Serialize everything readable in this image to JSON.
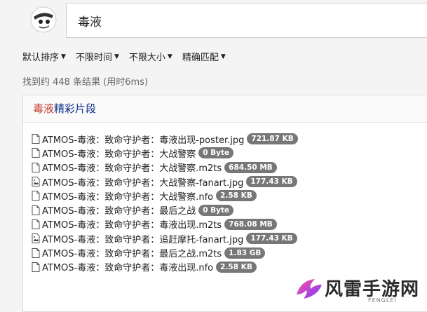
{
  "search": {
    "query": "毒液"
  },
  "filters": [
    {
      "label": "默认排序"
    },
    {
      "label": "不限时间"
    },
    {
      "label": "不限大小"
    },
    {
      "label": "精确匹配"
    }
  ],
  "stats": "找到约 448 条结果 (用时6ms)",
  "panel": {
    "title_highlight": "毒液",
    "title_rest": "精彩片段"
  },
  "files": [
    {
      "icon": "file-icon",
      "name": "ATMOS-毒液：致命守护者：毒液出现-poster.jpg",
      "size": "721.87 KB"
    },
    {
      "icon": "file-icon",
      "name": "ATMOS-毒液：致命守护者：大战警察",
      "size": "0 Byte"
    },
    {
      "icon": "file-icon",
      "name": "ATMOS-毒液：致命守护者：大战警察.m2ts",
      "size": "684.50 MB"
    },
    {
      "icon": "image-icon",
      "name": "ATMOS-毒液：致命守护者：大战警察-fanart.jpg",
      "size": "177.43 KB"
    },
    {
      "icon": "file-icon",
      "name": "ATMOS-毒液：致命守护者：大战警察.nfo",
      "size": "2.58 KB"
    },
    {
      "icon": "file-icon",
      "name": "ATMOS-毒液：致命守护者：最后之战",
      "size": "0 Byte"
    },
    {
      "icon": "file-icon",
      "name": "ATMOS-毒液：致命守护者：毒液出现.m2ts",
      "size": "768.08 MB"
    },
    {
      "icon": "image-icon",
      "name": "ATMOS-毒液：致命守护者：追赶摩托-fanart.jpg",
      "size": "177.43 KB"
    },
    {
      "icon": "file-icon",
      "name": "ATMOS-毒液：致命守护者：最后之战.m2ts",
      "size": "1.83 GB"
    },
    {
      "icon": "file-icon",
      "name": "ATMOS-毒液：致命守护者：毒液出现.nfo",
      "size": "2.58 KB"
    }
  ],
  "watermark": {
    "text": "风雷手游网",
    "sub": "FENGLEI"
  },
  "colors": {
    "highlight": "#c0392b",
    "badge": "#777777",
    "title": "#0b2e8a"
  }
}
